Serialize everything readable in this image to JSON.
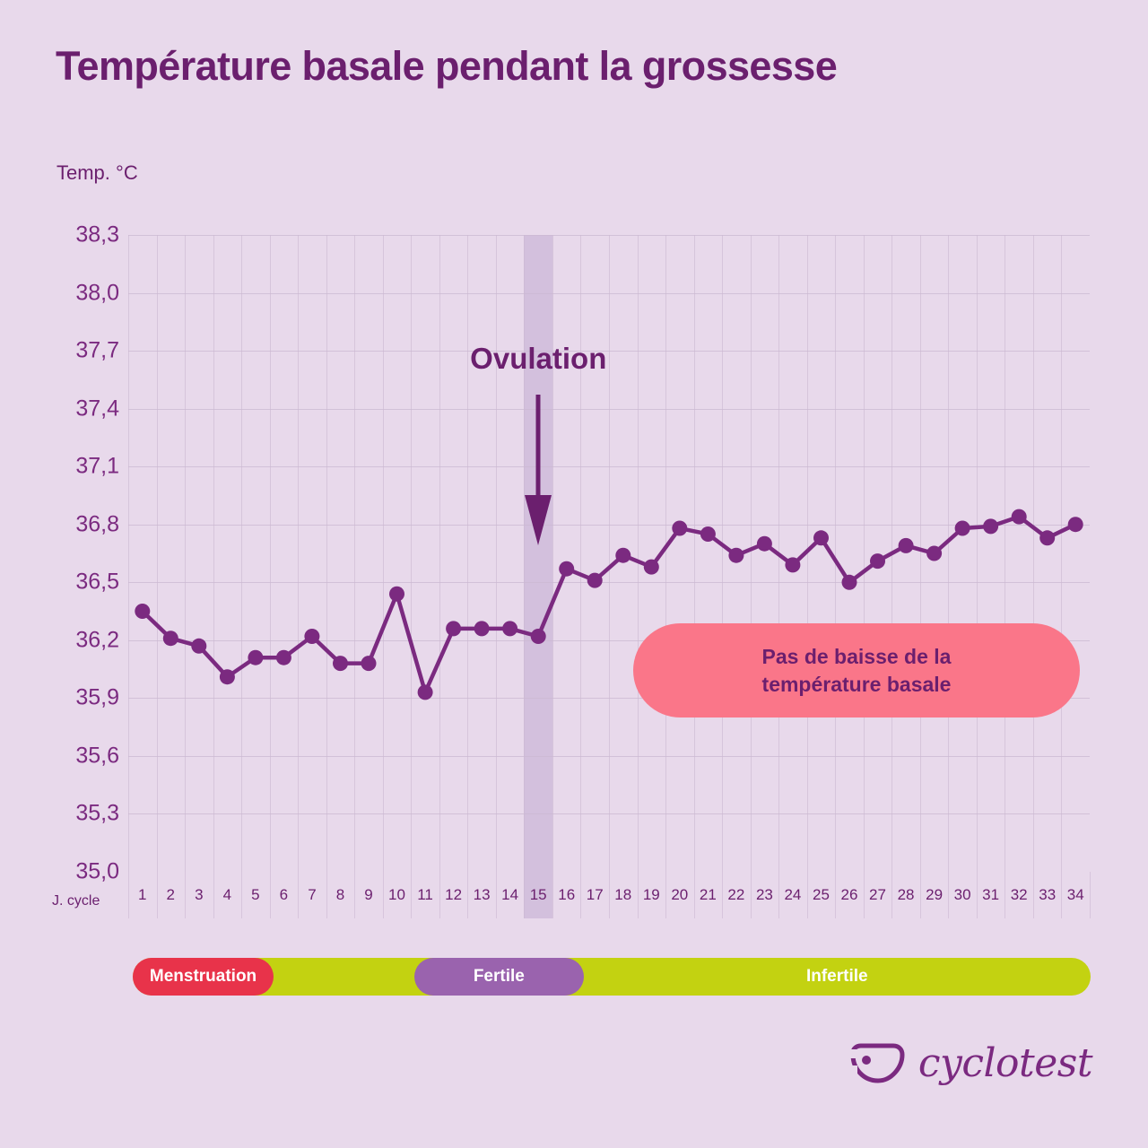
{
  "header": {
    "title": "Température basale pendant la grossesse"
  },
  "brand": {
    "name": "cyclotest",
    "mark": "cyclotest-logo-icon"
  },
  "colors": {
    "background": "#E8D9EB",
    "accent_purple": "#6B1F6E",
    "line": "#7B2A80",
    "grid": "#CBB8D2",
    "ovulation_band": "#CFBBDA",
    "callout_pink": "#FA7689",
    "menstruation_red": "#E8334A",
    "fertile_purple": "#9A63AE",
    "infertile_green": "#C3D211"
  },
  "annotations": {
    "ovulation_label": "Ovulation",
    "ovulation_day": 15,
    "callout_line1": "Pas de baisse de la",
    "callout_line2": "température basale"
  },
  "legend": {
    "items": [
      {
        "label": "Menstruation",
        "start_day": 1,
        "end_day": 5,
        "color": "#E8334A",
        "filled": true
      },
      {
        "label": "Fertile",
        "start_day": 11,
        "end_day": 16,
        "color": "#9A63AE",
        "filled": true
      },
      {
        "label": "Infertile",
        "start_day": 17,
        "end_day": 34,
        "color": "#C3D211",
        "filled": false
      }
    ]
  },
  "chart_data": {
    "type": "line",
    "title": "Température basale pendant la grossesse",
    "xlabel": "J. cycle",
    "ylabel": "Temp. °C",
    "ylim": [
      35.0,
      38.3
    ],
    "yticks": [
      "38,3",
      "38,0",
      "37,7",
      "37,4",
      "37,1",
      "36,8",
      "36,5",
      "36,2",
      "35,9",
      "35,6",
      "35,3",
      "35,0"
    ],
    "ytick_values": [
      38.3,
      38.0,
      37.7,
      37.4,
      37.1,
      36.8,
      36.5,
      36.2,
      35.9,
      35.6,
      35.3,
      35.0
    ],
    "grid": true,
    "legend_position": "bottom",
    "categories": [
      1,
      2,
      3,
      4,
      5,
      6,
      7,
      8,
      9,
      10,
      11,
      12,
      13,
      14,
      15,
      16,
      17,
      18,
      19,
      20,
      21,
      22,
      23,
      24,
      25,
      26,
      27,
      28,
      29,
      30,
      31,
      32,
      33,
      34
    ],
    "series": [
      {
        "name": "Température basale",
        "color": "#7B2A80",
        "values": [
          36.35,
          36.21,
          36.17,
          36.01,
          36.11,
          36.11,
          36.22,
          36.08,
          36.08,
          36.44,
          35.93,
          36.26,
          36.26,
          36.26,
          36.22,
          36.57,
          36.51,
          36.64,
          36.58,
          36.78,
          36.75,
          36.64,
          36.7,
          36.59,
          36.73,
          36.5,
          36.61,
          36.69,
          36.65,
          36.78,
          36.79,
          36.84,
          36.73,
          36.8
        ]
      }
    ]
  }
}
